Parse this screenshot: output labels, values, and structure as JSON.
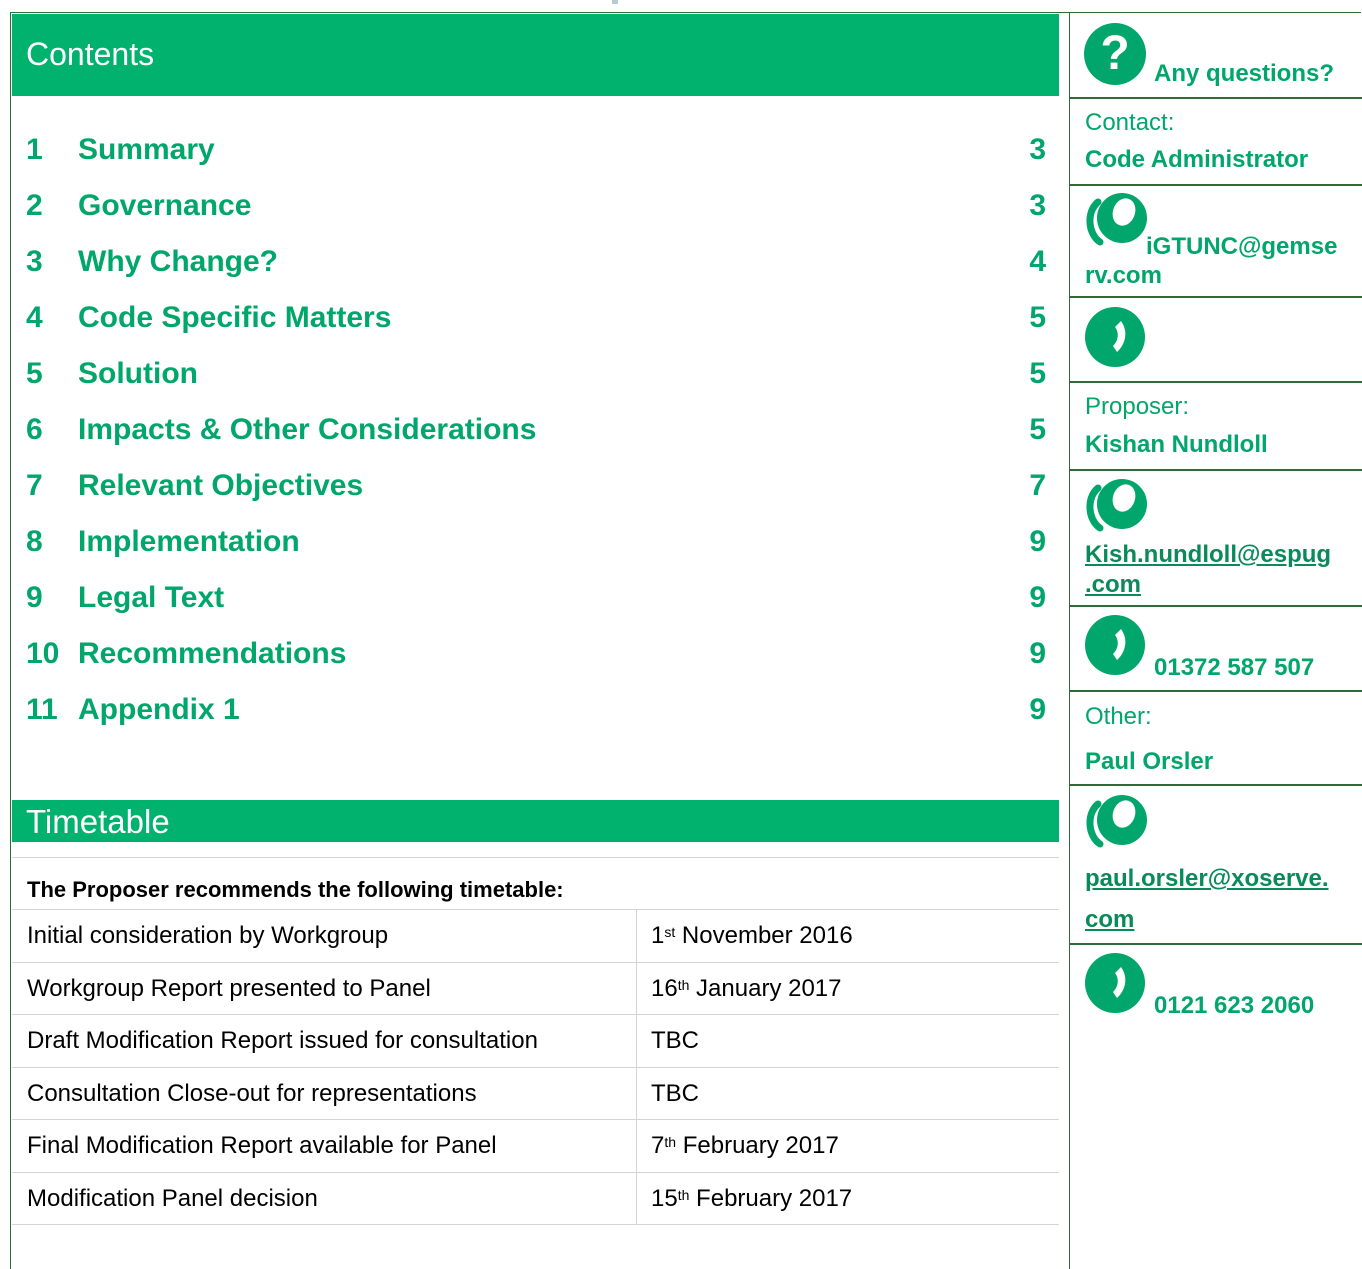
{
  "contents": {
    "heading": "Contents",
    "items": [
      {
        "num": "1",
        "title": "Summary",
        "page": "3"
      },
      {
        "num": "2",
        "title": "Governance",
        "page": "3"
      },
      {
        "num": "3",
        "title": "Why Change?",
        "page": "4"
      },
      {
        "num": "4",
        "title": "Code Specific Matters",
        "page": "5"
      },
      {
        "num": "5",
        "title": "Solution",
        "page": "5"
      },
      {
        "num": "6",
        "title": "Impacts & Other Considerations",
        "page": "5"
      },
      {
        "num": "7",
        "title": "Relevant Objectives",
        "page": "7"
      },
      {
        "num": "8",
        "title": "Implementation",
        "page": "9"
      },
      {
        "num": "9",
        "title": "Legal Text",
        "page": "9"
      },
      {
        "num": "10",
        "title": "Recommendations",
        "page": "9"
      },
      {
        "num": "11",
        "title": "Appendix 1",
        "page": "9"
      }
    ]
  },
  "timetable": {
    "heading": "Timetable",
    "intro": "The Proposer recommends the following timetable:",
    "rows": [
      {
        "label": "Initial consideration by Workgroup",
        "day": "1",
        "sup": "st",
        "rest": " November 2016"
      },
      {
        "label": "Workgroup Report presented to Panel",
        "day": "16",
        "sup": "th",
        "rest": " January 2017"
      },
      {
        "label": "Draft Modification Report issued for consultation",
        "day": "TBC",
        "sup": "",
        "rest": ""
      },
      {
        "label": "Consultation Close-out for representations",
        "day": "TBC",
        "sup": "",
        "rest": ""
      },
      {
        "label": "Final Modification Report available for Panel",
        "day": "7",
        "sup": "th",
        "rest": " February 2017"
      },
      {
        "label": "Modification Panel decision",
        "day": "15",
        "sup": "th",
        "rest": " February 2017"
      }
    ]
  },
  "sidebar": {
    "questions_label": "Any questions?",
    "contact_label": "Contact:",
    "contact_name": "Code Administrator",
    "contact_email_line1": "iGTUNC@gemse",
    "contact_email_line2": "rv.com",
    "proposer_label": "Proposer:",
    "proposer_name": "Kishan Nundloll",
    "proposer_email_line1": "Kish.nundloll@espug",
    "proposer_email_line2": ".com",
    "proposer_phone": "01372 587 507",
    "other_label": "Other:",
    "other_name": "Paul Orsler",
    "other_email_line1": "paul.orsler@xoserve.",
    "other_email_line2": "com",
    "other_phone": "0121 623 2060"
  },
  "icons": {
    "question": "question-mark-icon",
    "email": "email-icon",
    "phone": "phone-icon"
  },
  "colors": {
    "accent_green": "#00b26e",
    "text_green": "#00a66b",
    "rule_green": "#2f6b3a"
  }
}
